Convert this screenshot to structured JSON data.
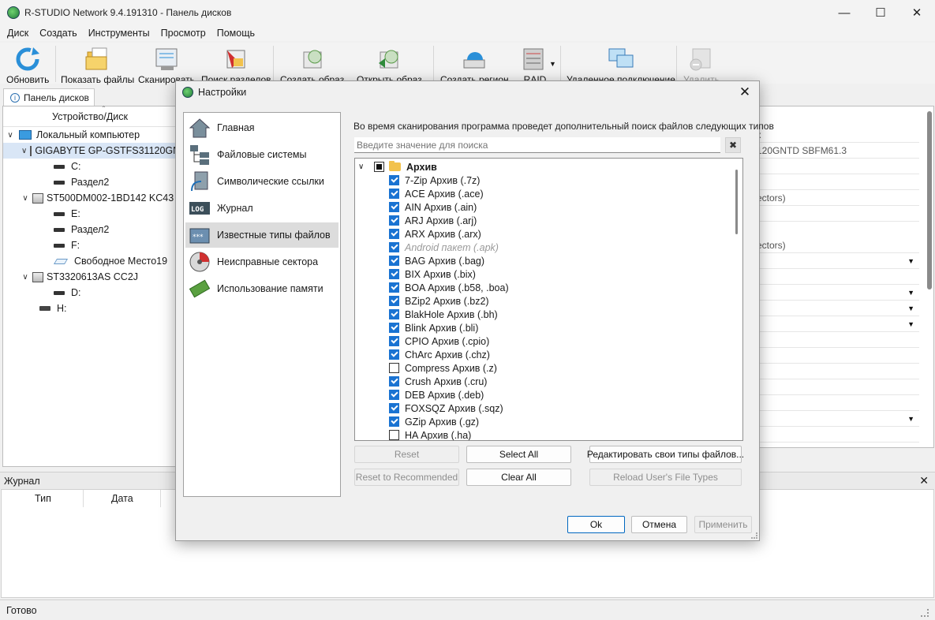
{
  "window": {
    "title": "R-STUDIO Network 9.4.191310 - Панель дисков"
  },
  "menu": [
    "Диск",
    "Создать",
    "Инструменты",
    "Просмотр",
    "Помощь"
  ],
  "toolbar": {
    "refresh": "Обновить",
    "show_files": "Показать файлы",
    "scan": "Сканировать",
    "find_partitions": "Поиск разделов",
    "create_image": "Создать образ",
    "open_image": "Открыть образ",
    "create_region": "Создать регион",
    "raid": "RAID",
    "remote": "Удаленное подключение",
    "delete": "Удалить"
  },
  "left_panel": {
    "tab": "Панель дисков",
    "column": "Устройство/Диск",
    "tree": [
      {
        "label": "Локальный компьютер"
      },
      {
        "label": "GIGABYTE GP-GSTFS31120GN"
      },
      {
        "label": "C:"
      },
      {
        "label": "Раздел2"
      },
      {
        "label": "ST500DM002-1BD142 KC43"
      },
      {
        "label": "E:"
      },
      {
        "label": "Раздел2"
      },
      {
        "label": "F:"
      },
      {
        "label": "Свободное Место19"
      },
      {
        "label": "ST3320613AS CC2J"
      },
      {
        "label": "D:"
      },
      {
        "label": "H:"
      }
    ]
  },
  "right_panel": {
    "rows": [
      "к",
      "120GNTD SBFM61.3",
      "",
      "l",
      "ectors)",
      "",
      "ectors)"
    ]
  },
  "journal": {
    "title": "Журнал",
    "col_type": "Тип",
    "col_date": "Дата"
  },
  "status": "Готово",
  "dialog": {
    "title": "Настройки",
    "nav": [
      "Главная",
      "Файловые системы",
      "Символические ссылки",
      "Журнал",
      "Известные типы файлов",
      "Неисправные сектора",
      "Использование памяти"
    ],
    "hint": "Во время сканирования программа проведет дополнительный поиск файлов следующих типов",
    "search_placeholder": "Введите значение для поиска",
    "group": "Архив",
    "file_types": [
      {
        "label": "7-Zip Архив (.7z)",
        "checked": true
      },
      {
        "label": "ACE Архив (.ace)",
        "checked": true
      },
      {
        "label": "AIN Архив (.ain)",
        "checked": true
      },
      {
        "label": "ARJ Архив (.arj)",
        "checked": true
      },
      {
        "label": "ARX Архив (.arx)",
        "checked": true
      },
      {
        "label": "Android пакет (.apk)",
        "checked": true,
        "disabled": true
      },
      {
        "label": "BAG Архив (.bag)",
        "checked": true
      },
      {
        "label": "BIX Архив (.bix)",
        "checked": true
      },
      {
        "label": "BOA Архив (.b58, .boa)",
        "checked": true
      },
      {
        "label": "BZip2 Архив (.bz2)",
        "checked": true
      },
      {
        "label": "BlakHole Архив (.bh)",
        "checked": true
      },
      {
        "label": "Blink Архив (.bli)",
        "checked": true
      },
      {
        "label": "CPIO Архив (.cpio)",
        "checked": true
      },
      {
        "label": "ChArc Архив (.chz)",
        "checked": true
      },
      {
        "label": "Compress Архив (.z)",
        "checked": false
      },
      {
        "label": "Crush Архив (.cru)",
        "checked": true
      },
      {
        "label": "DEB Архив (.deb)",
        "checked": true
      },
      {
        "label": "FOXSQZ Архив (.sqz)",
        "checked": true
      },
      {
        "label": "GZip Архив (.gz)",
        "checked": true
      },
      {
        "label": "HA Архив (.ha)",
        "checked": false
      }
    ],
    "buttons": {
      "reset": "Reset",
      "select_all": "Select All",
      "edit_types": "Редактировать свои типы файлов...",
      "reset_recommended": "Reset to Recommended",
      "clear_all": "Clear All",
      "reload_types": "Reload User's File Types",
      "ok": "Ok",
      "cancel": "Отмена",
      "apply": "Применить"
    }
  }
}
